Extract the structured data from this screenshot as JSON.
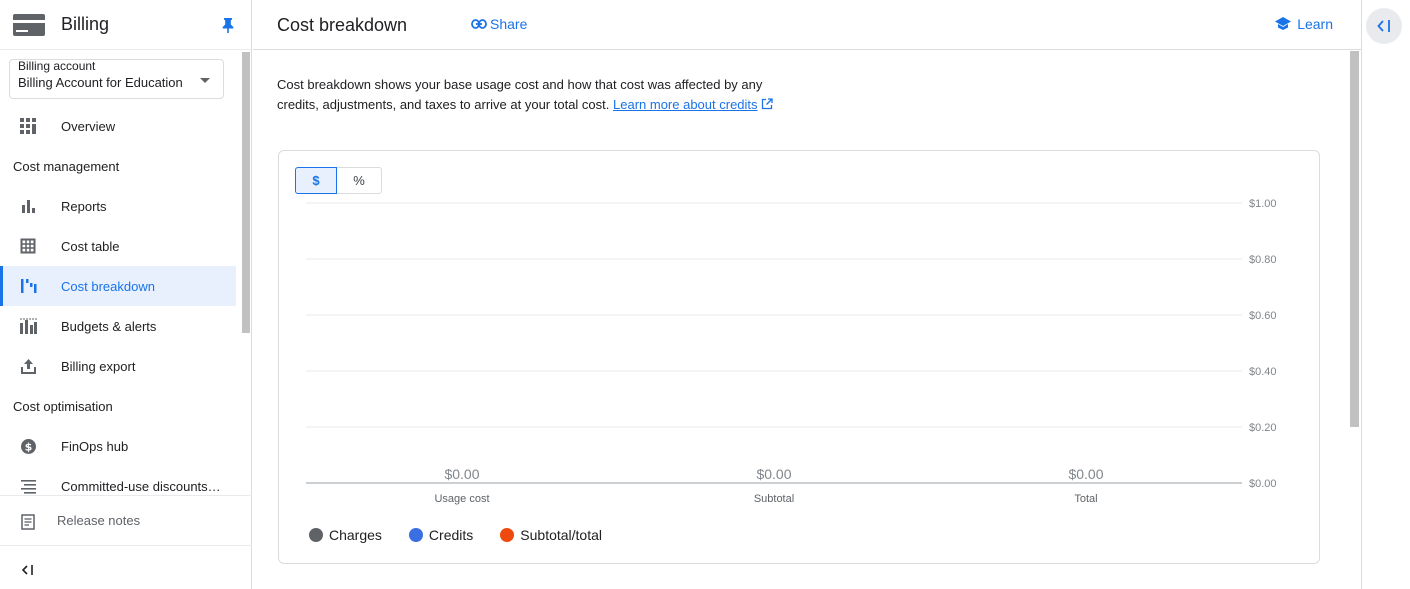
{
  "sidebar": {
    "title": "Billing",
    "account_label": "Billing account",
    "account_value": "Billing Account for Education",
    "items": [
      {
        "type": "item",
        "label": "Overview",
        "icon": "dashboard-icon"
      },
      {
        "type": "section",
        "label": "Cost management"
      },
      {
        "type": "item",
        "label": "Reports",
        "icon": "bar-chart-icon"
      },
      {
        "type": "item",
        "label": "Cost table",
        "icon": "table-icon"
      },
      {
        "type": "item",
        "label": "Cost breakdown",
        "icon": "waterfall-icon",
        "active": true
      },
      {
        "type": "item",
        "label": "Budgets & alerts",
        "icon": "budget-icon"
      },
      {
        "type": "item",
        "label": "Billing export",
        "icon": "export-icon"
      },
      {
        "type": "section",
        "label": "Cost optimisation"
      },
      {
        "type": "item",
        "label": "FinOps hub",
        "icon": "dollar-circle-icon"
      },
      {
        "type": "item",
        "label": "Committed-use discounts…",
        "icon": "list-icon"
      }
    ],
    "release_notes": "Release notes"
  },
  "header": {
    "title": "Cost breakdown",
    "share_label": "Share",
    "learn_label": "Learn"
  },
  "description": {
    "text": "Cost breakdown shows your base usage cost and how that cost was affected by any credits, adjustments, and taxes to arrive at your total cost. ",
    "link": "Learn more about credits"
  },
  "toggle": {
    "dollar": "$",
    "percent": "%"
  },
  "colors": {
    "accent": "#1a73e8",
    "charges": "#5f6368",
    "credits": "#3b6ee0",
    "subtotal": "#ee4a0f"
  },
  "chart_data": {
    "type": "bar",
    "categories": [
      "Usage cost",
      "Subtotal",
      "Total"
    ],
    "values": [
      0,
      0,
      0
    ],
    "data_labels": [
      "$0.00",
      "$0.00",
      "$0.00"
    ],
    "yticks": [
      "$0.00",
      "$0.20",
      "$0.40",
      "$0.60",
      "$0.80",
      "$1.00"
    ],
    "ylim": [
      0,
      1
    ],
    "yaxis_position": "right",
    "grid": true,
    "legend": [
      {
        "name": "Charges",
        "color": "#5f6368"
      },
      {
        "name": "Credits",
        "color": "#3b6ee0"
      },
      {
        "name": "Subtotal/total",
        "color": "#ee4a0f"
      }
    ],
    "legend_position": "bottom-left"
  }
}
